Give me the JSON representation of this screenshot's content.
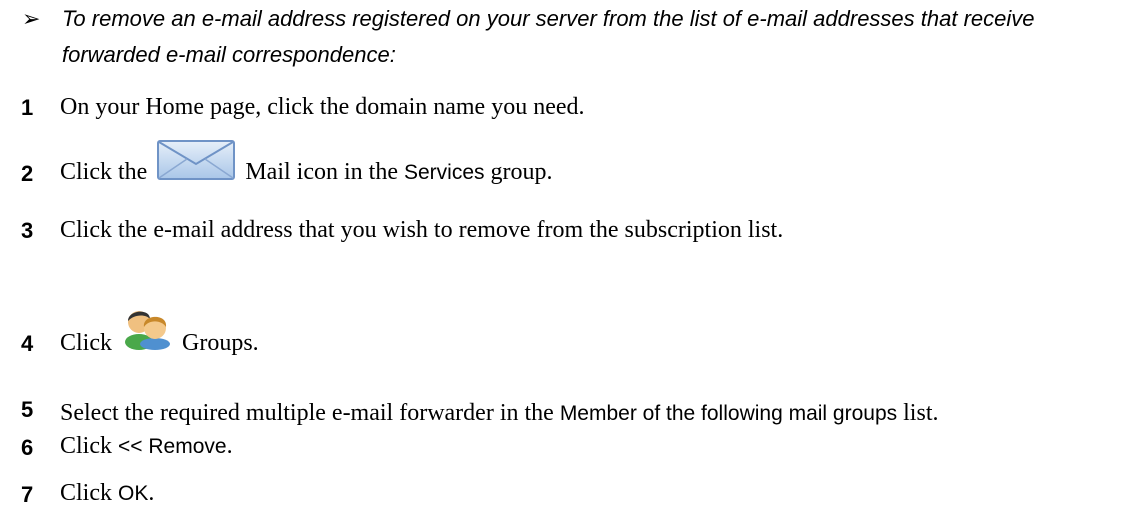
{
  "heading": {
    "bullet": "➢",
    "text": "To remove an e-mail address registered on your server from the list of e-mail addresses that receive forwarded e-mail correspondence:"
  },
  "steps": [
    {
      "number": "1",
      "text": "On your Home page, click the domain name you need."
    },
    {
      "number": "2",
      "before": "Click the",
      "after_icon": "Mail icon in the",
      "ui": "Services",
      "after": "group.",
      "icon": "mail-envelope-icon"
    },
    {
      "number": "3",
      "text": "Click the e-mail address that you wish to remove from the subscription list."
    },
    {
      "number": "4",
      "before": "Click",
      "after": "Groups.",
      "icon": "groups-users-icon"
    },
    {
      "number": "5",
      "before": "Select the required multiple e-mail forwarder in the",
      "ui": "Member of the following mail groups",
      "after": "list."
    },
    {
      "number": "6",
      "before": "Click",
      "ui": "<< Remove",
      "after": "."
    },
    {
      "number": "7",
      "before": "Click",
      "ui": "OK",
      "after": "."
    }
  ],
  "colors": {
    "envelope_fill": "#cfe0f1",
    "envelope_stroke": "#6f93c6",
    "user_green": "#4aa84a",
    "user_blue": "#4f90d0",
    "skin": "#f0c080",
    "hair_dark": "#333333",
    "hair_light": "#c8882a"
  }
}
